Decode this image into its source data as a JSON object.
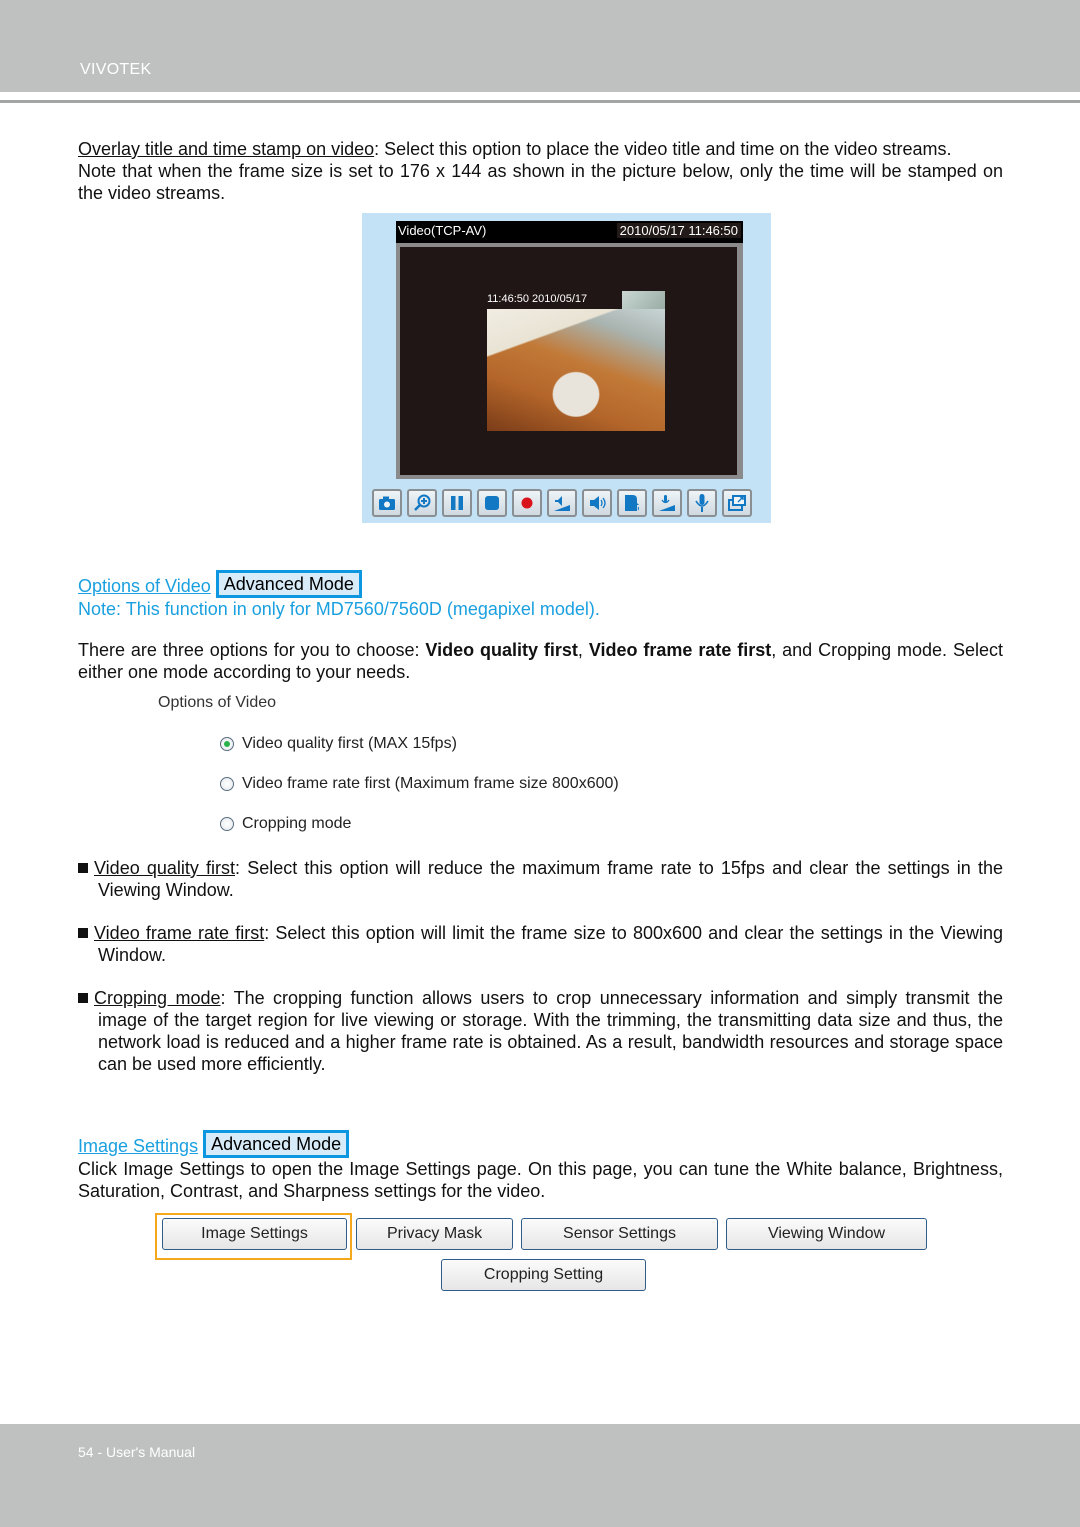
{
  "header": {
    "brand": "VIVOTEK"
  },
  "overlay": {
    "term": "Overlay title and time stamp on video",
    "desc": ": Select this option to place the video title and time on the video streams.",
    "note": "Note that when the frame size is set to 176 x 144 as shown in the picture below, only the time will be stamped on the video streams."
  },
  "video_widget": {
    "title": "Video(TCP-AV)",
    "datetime": "2010/05/17  11:46:50",
    "stamp": "11:46:50 2010/05/17",
    "toolbar": [
      {
        "icon": "camera-icon",
        "label": "Snapshot"
      },
      {
        "icon": "zoom-in-icon",
        "label": "Digital zoom"
      },
      {
        "icon": "pause-icon",
        "label": "Pause"
      },
      {
        "icon": "stop-icon",
        "label": "Stop"
      },
      {
        "icon": "record-icon",
        "label": "Record"
      },
      {
        "icon": "volume-icon",
        "label": "Volume"
      },
      {
        "icon": "mute-icon",
        "label": "Mute"
      },
      {
        "icon": "talk-icon",
        "label": "Talk"
      },
      {
        "icon": "mic-volume-icon",
        "label": "Mic volume"
      },
      {
        "icon": "mic-icon",
        "label": "Mic"
      },
      {
        "icon": "fullscreen-icon",
        "label": "Full screen"
      }
    ]
  },
  "options_section": {
    "link": "Options of Video",
    "badge": "Advanced Mode",
    "note": "Note: This function in only for MD7560/7560D (megapixel model).",
    "intro_a": "There are three options for you to choose: ",
    "intro_b1": "Video quality first",
    "intro_sep": ", ",
    "intro_b2": "Video frame rate first",
    "intro_c": ", and Cropping mode. Select either one mode according to your needs.",
    "panel_title": "Options of Video",
    "radios": [
      {
        "label": "Video quality first (MAX 15fps)",
        "checked": true
      },
      {
        "label": "Video frame rate first (Maximum frame size 800x600)",
        "checked": false
      },
      {
        "label": "Cropping mode",
        "checked": false
      }
    ],
    "bullets": [
      {
        "term": "Video quality first",
        "text": ": Select this option will reduce the maximum frame rate to 15fps and clear the settings in the Viewing Window."
      },
      {
        "term": "Video frame rate first",
        "text": ": Select this option will limit the frame size to 800x600 and clear the settings in the Viewing Window."
      },
      {
        "term": "Cropping mode",
        "text": ": The cropping function allows users to crop unnecessary information and simply transmit the image of the target region for live viewing or storage. With the trimming, the transmitting data size and thus, the network load is reduced and a higher frame rate is obtained. As a result, bandwidth resources and storage space can be used more efficiently."
      }
    ]
  },
  "image_section": {
    "link": "Image Settings",
    "badge": "Advanced Mode",
    "desc": "Click Image Settings to open the Image Settings page. On this page, you can tune the White balance, Brightness, Saturation, Contrast, and Sharpness settings for the video.",
    "buttons": [
      "Image Settings",
      "Privacy Mask",
      "Sensor Settings",
      "Viewing Window",
      "Cropping Setting"
    ]
  },
  "footer": {
    "page": "54 - User's Manual"
  },
  "colors": {
    "accent_blue": "#1aa0e0",
    "highlight_orange": "#f6a81c",
    "band_gray": "#bfc1c0"
  }
}
